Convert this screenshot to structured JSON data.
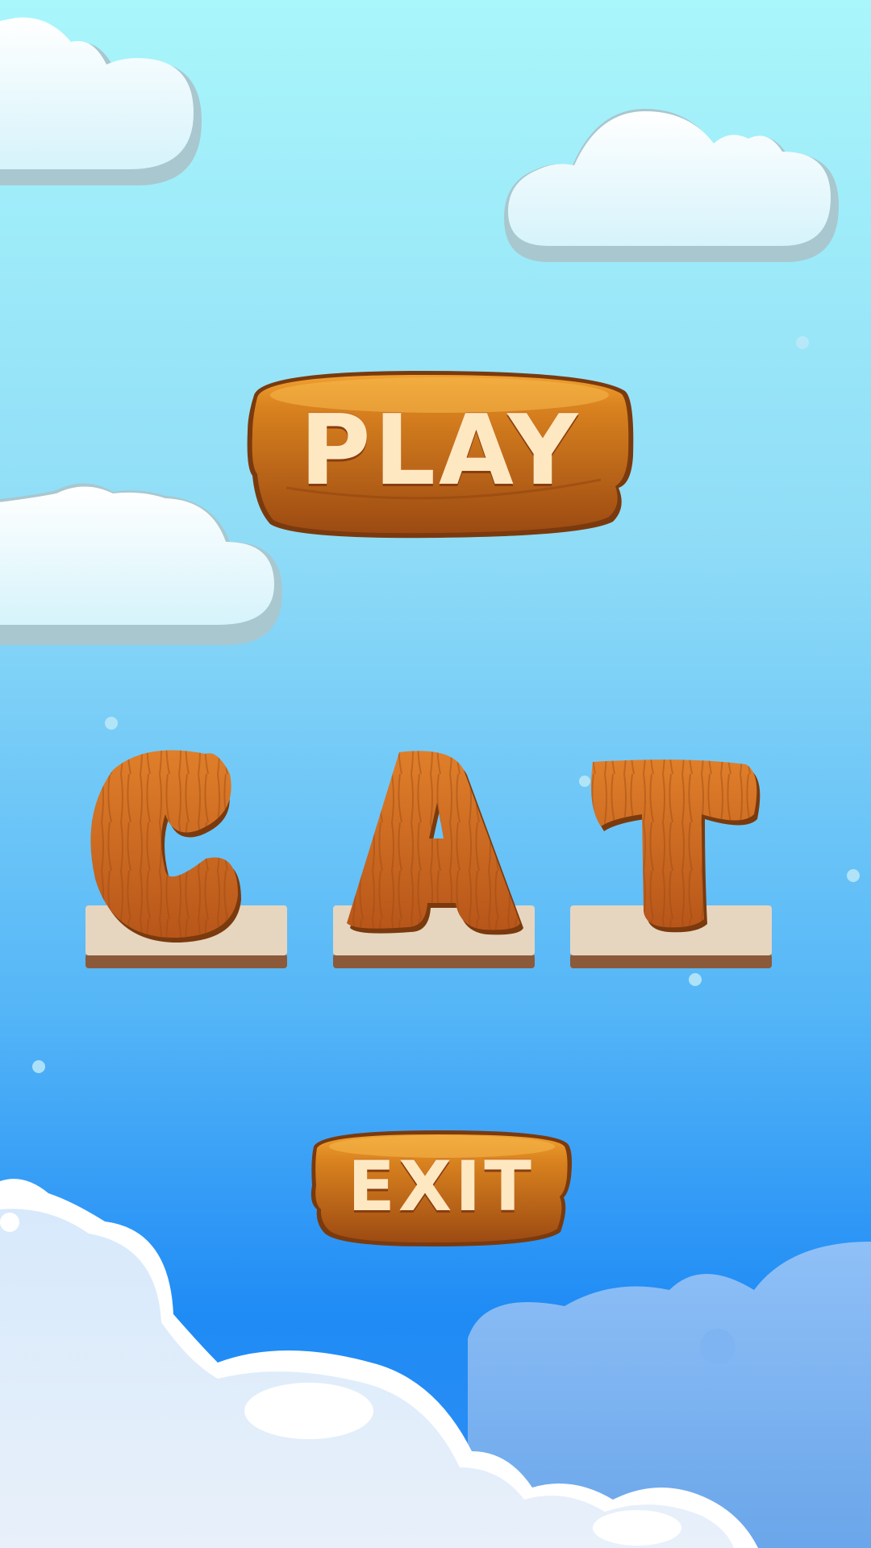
{
  "screen": {
    "title": ""
  },
  "buttons": {
    "play_label": "PLAY",
    "exit_label": "EXIT"
  },
  "word": {
    "letters": [
      "C",
      "A",
      "T"
    ]
  },
  "colors": {
    "sky_top": "#a9f6fb",
    "sky_bottom": "#2f8ff2",
    "wood_light": "#e48a2a",
    "wood_dark": "#9c4a12",
    "button_text": "#fde8c2",
    "slot_top": "#e6d6c0",
    "slot_edge": "#8a5a3a"
  },
  "icons": {
    "clouds": "cloud-icon",
    "bubbles": "bubble-icon"
  }
}
